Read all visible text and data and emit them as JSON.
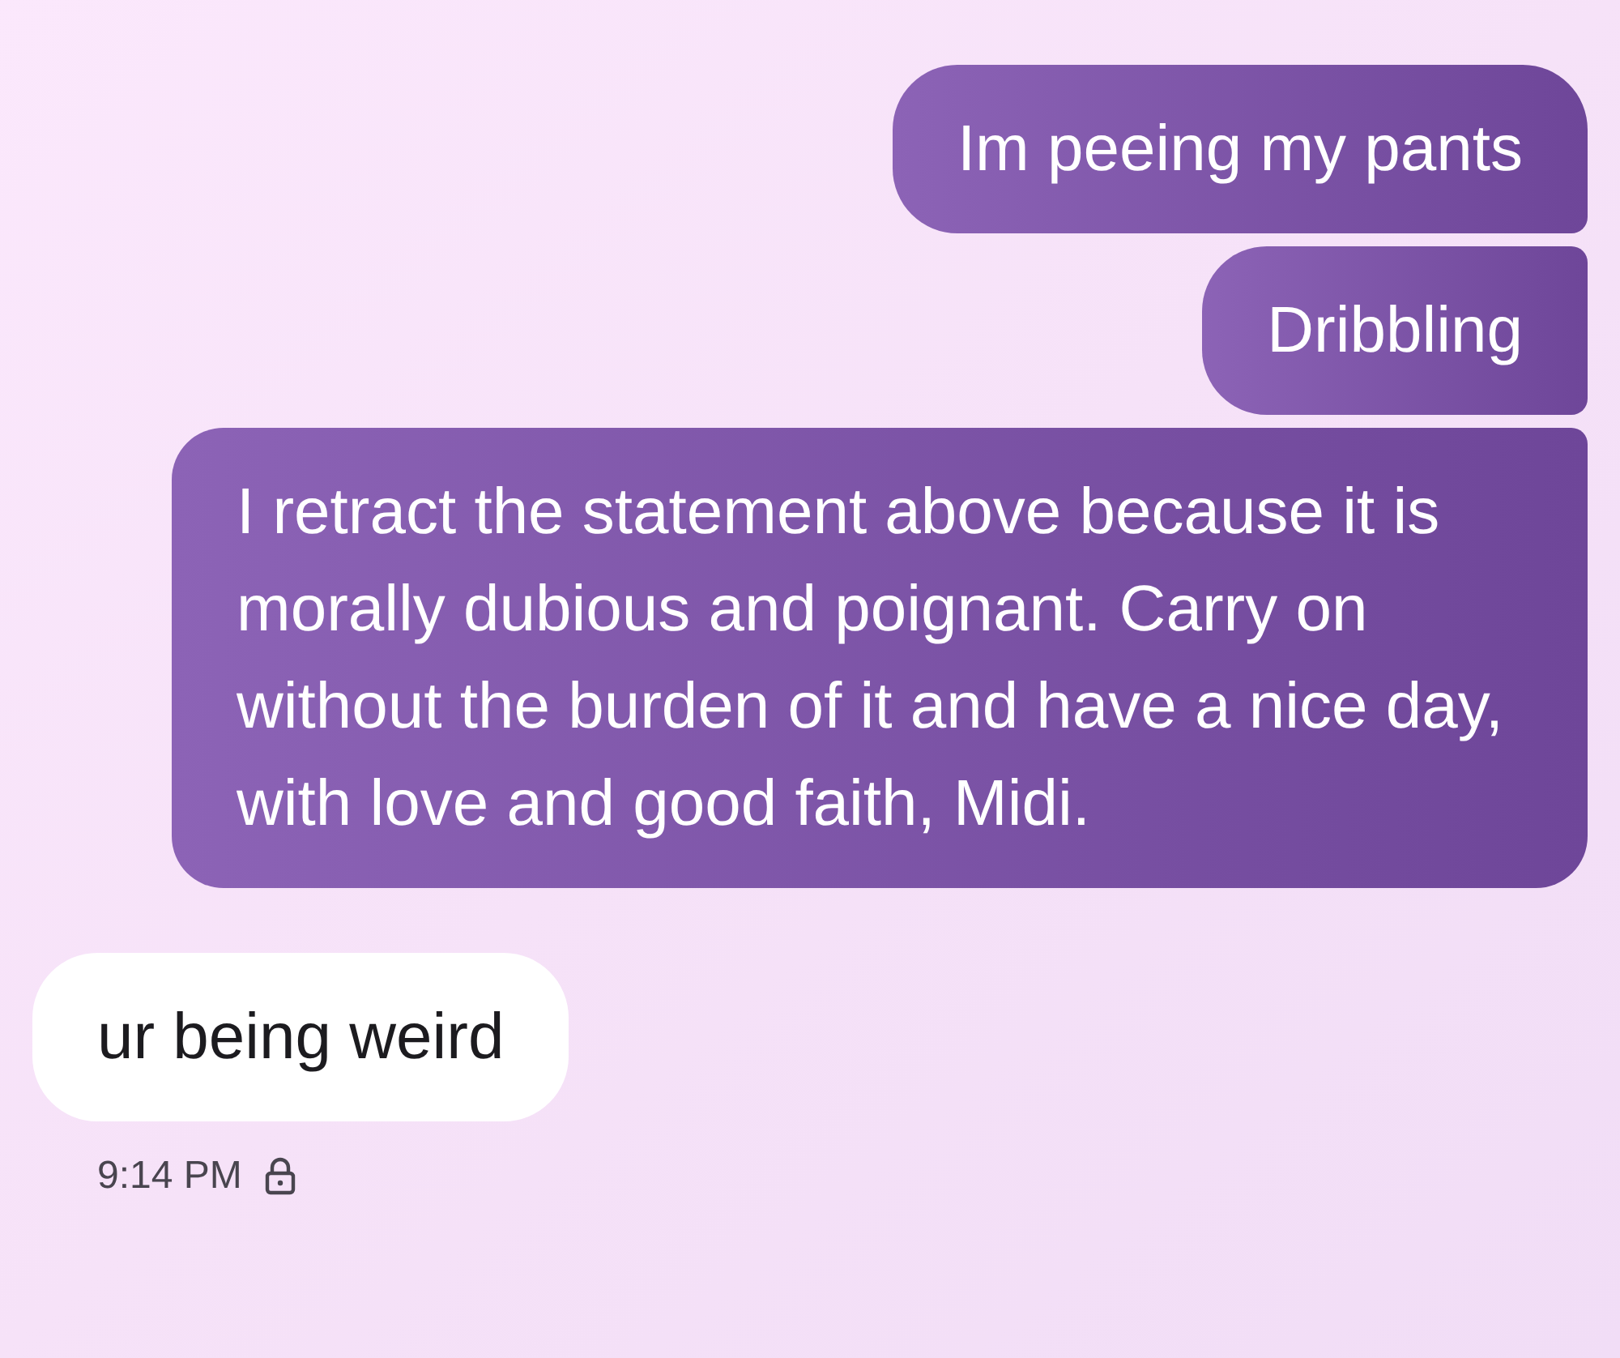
{
  "messages": [
    {
      "kind": "sent",
      "text": "Im peeing my pants"
    },
    {
      "kind": "sent",
      "text": "Dribbling"
    },
    {
      "kind": "sent",
      "text": "I retract the statement above because it is morally dubious and poignant. Carry on without the burden of it and have a nice day, with love and good faith, Midi."
    },
    {
      "kind": "received",
      "text": "ur being weird"
    }
  ],
  "status": {
    "time": "9:14 PM",
    "locked": true
  }
}
